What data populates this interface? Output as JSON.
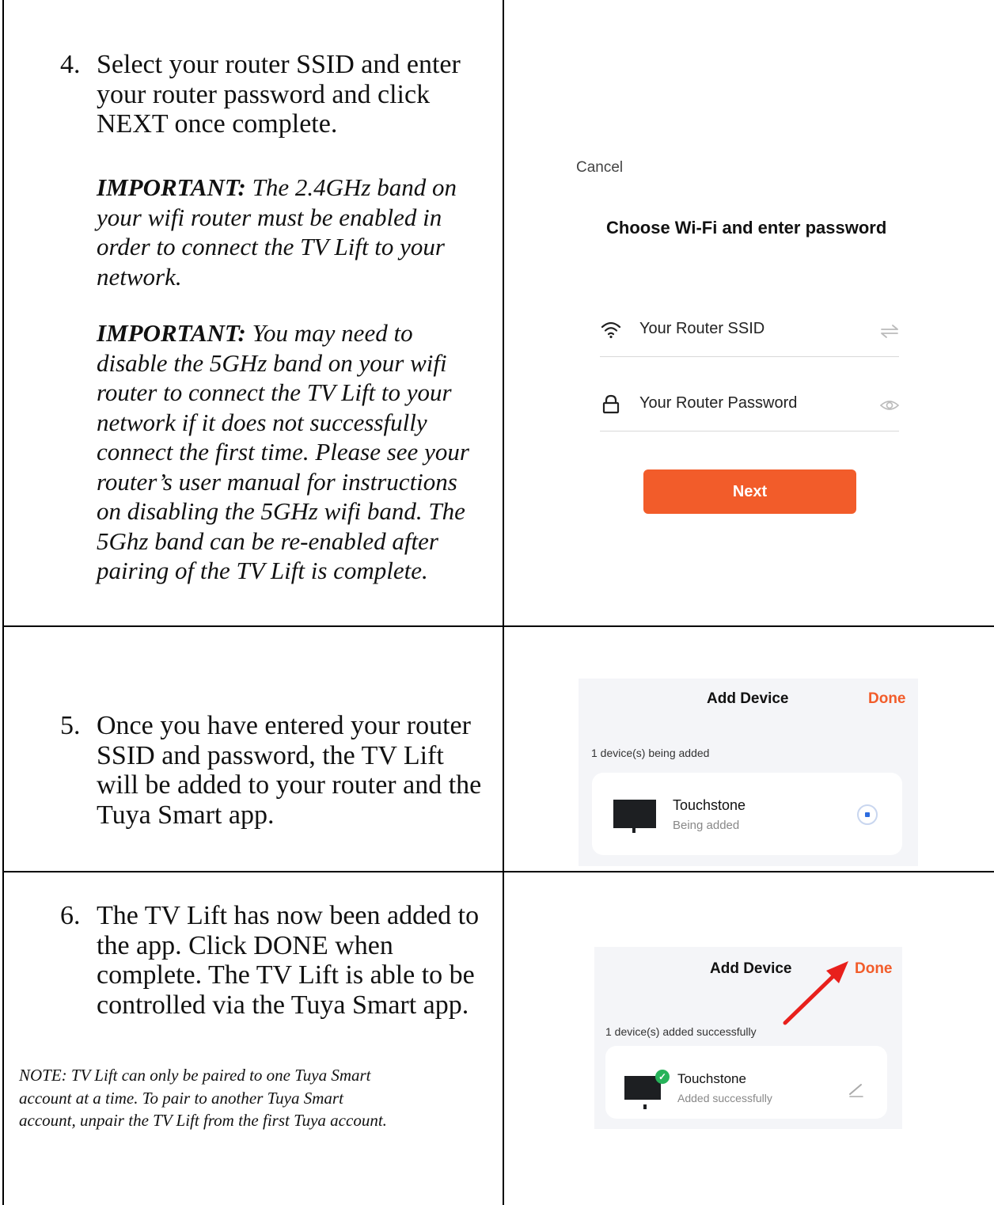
{
  "step4": {
    "number": "4.",
    "lines": [
      "Select your router SSID and enter",
      "your router password and click",
      "NEXT once complete."
    ],
    "important1": {
      "label": "IMPORTANT:",
      "lines": [
        "The 2.4GHz band on",
        "your wifi router must be enabled in",
        "order to connect the TV Lift to your",
        "network."
      ]
    },
    "important2": {
      "label": "IMPORTANT:",
      "lines": [
        "You may need to",
        "disable the 5GHz band on your wifi",
        "router to connect the TV Lift to your",
        "network if it does not successfully",
        "connect the first time.  Please see your",
        "router’s user manual for instructions",
        "on disabling the 5GHz wifi band.  The",
        "5Ghz band can be re-enabled after",
        "pairing of the TV Lift is complete."
      ]
    }
  },
  "step5": {
    "number": "5.",
    "lines": [
      "Once you have entered your router",
      "SSID and password, the TV Lift",
      "will be added to your router and the",
      "Tuya Smart app."
    ]
  },
  "step6": {
    "number": "6.",
    "lines": [
      "The TV Lift has now been added to",
      "the app.  Click DONE when",
      "complete. The TV Lift is able to be",
      "controlled via the Tuya Smart app."
    ],
    "note_lines": [
      "NOTE: TV Lift can only be paired to one Tuya Smart",
      "account at a time.  To pair to another Tuya Smart",
      "account, unpair the TV Lift from the first Tuya account."
    ]
  },
  "wifi_screen": {
    "cancel": "Cancel",
    "title": "Choose Wi-Fi and enter password",
    "ssid_field": "Your Router SSID",
    "password_field": "Your Router Password",
    "next_button": "Next",
    "icons": [
      "wifi-icon",
      "swap-icon",
      "lock-icon",
      "eye-icon"
    ]
  },
  "adding_screen": {
    "title": "Add Device",
    "done": "Done",
    "status": "1 device(s) being added",
    "device_name": "Touchstone",
    "device_status": "Being added"
  },
  "added_screen": {
    "title": "Add Device",
    "done": "Done",
    "status": "1 device(s) added successfully",
    "device_name": "Touchstone",
    "device_status": "Added successfully"
  },
  "colors": {
    "accent": "#f25c2a",
    "success": "#27b35a",
    "arrow": "#e8201c",
    "panel": "#f4f5f8"
  }
}
